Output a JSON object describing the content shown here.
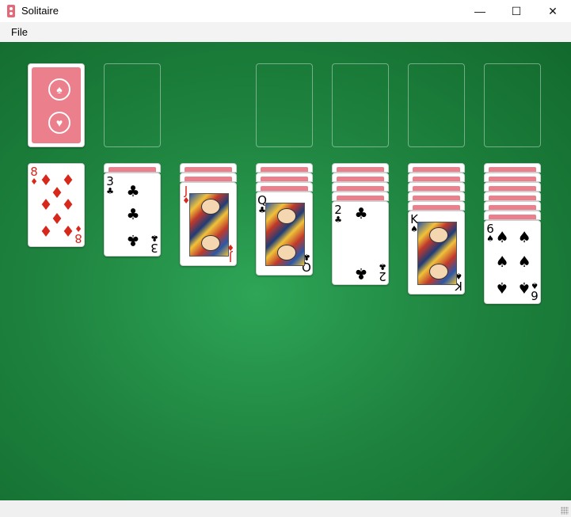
{
  "window": {
    "title": "Solitaire",
    "minimize_glyph": "—",
    "maximize_glyph": "☐",
    "close_glyph": "✕"
  },
  "menu": {
    "file": "File"
  },
  "colors": {
    "felt": "#1f8540",
    "card_back": "#ec7f8c",
    "red_suit": "#d8281c"
  },
  "stock": {
    "emblem_top": "♠",
    "emblem_bottom": "♥"
  },
  "tableau": [
    {
      "face_down": 0,
      "rank": "8",
      "suit": "♦",
      "color": "red"
    },
    {
      "face_down": 1,
      "rank": "3",
      "suit": "♣",
      "color": "black"
    },
    {
      "face_down": 2,
      "rank": "J",
      "suit": "♦",
      "color": "red"
    },
    {
      "face_down": 3,
      "rank": "Q",
      "suit": "♣",
      "color": "black"
    },
    {
      "face_down": 4,
      "rank": "2",
      "suit": "♣",
      "color": "black"
    },
    {
      "face_down": 5,
      "rank": "K",
      "suit": "♠",
      "color": "black"
    },
    {
      "face_down": 6,
      "rank": "6",
      "suit": "♠",
      "color": "black"
    }
  ]
}
